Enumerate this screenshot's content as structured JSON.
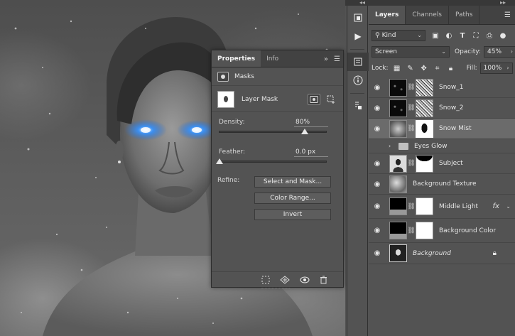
{
  "properties": {
    "tabs": [
      "Properties",
      "Info"
    ],
    "section_title": "Masks",
    "mask_name": "Layer Mask",
    "density": {
      "label": "Density:",
      "value": "80%",
      "fraction": 0.8
    },
    "feather": {
      "label": "Feather:",
      "value": "0.0 px",
      "fraction": 0.0
    },
    "refine_label": "Refine:",
    "buttons": {
      "select_and_mask": "Select and Mask...",
      "color_range": "Color Range...",
      "invert": "Invert"
    }
  },
  "layers_panel": {
    "tabs": [
      "Layers",
      "Channels",
      "Paths"
    ],
    "filter": {
      "value": "Kind"
    },
    "blend_mode": "Screen",
    "opacity": {
      "label": "Opacity:",
      "value": "45%"
    },
    "lock_label": "Lock:",
    "fill": {
      "label": "Fill:",
      "value": "100%"
    },
    "layers": [
      {
        "name": "Snow_1",
        "thumb": "stars",
        "mask": "noise",
        "selected": false
      },
      {
        "name": "Snow_2",
        "thumb": "stars",
        "mask": "noise",
        "selected": false
      },
      {
        "name": "Snow Mist",
        "thumb": "mist",
        "mask": "maskblob",
        "selected": true
      },
      {
        "name": "Eyes Glow",
        "group": true
      },
      {
        "name": "Subject",
        "thumb": "person",
        "mask": "maskshoulder",
        "selected": false
      },
      {
        "name": "Background Texture",
        "thumb": "tex",
        "selected": false
      },
      {
        "name": "Middle Light",
        "thumb": "fxblack",
        "mask": "white",
        "fx": "fx",
        "selected": false
      },
      {
        "name": "Background Color",
        "thumb": "fxblack",
        "mask": "white",
        "selected": false
      },
      {
        "name": "Background",
        "thumb": "bgthumb",
        "locked": true,
        "italic": true,
        "selected": false
      }
    ]
  },
  "colors": {
    "panel_bg": "#535353",
    "tab_bg": "#424242",
    "eye_glow": "#2a7fe0",
    "selected_row": "#6b6b6b"
  }
}
